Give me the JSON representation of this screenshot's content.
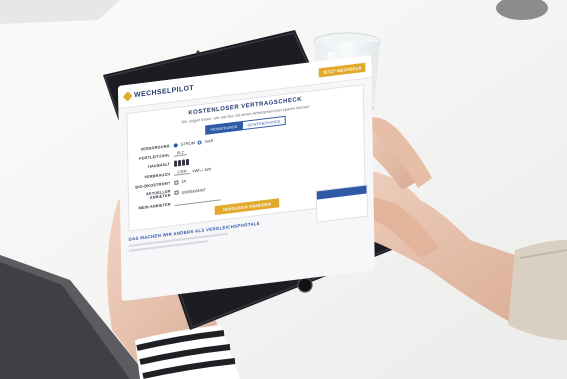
{
  "screen": {
    "logo": "WECHSELPILOT",
    "header_button": "JETZT WECHSELN",
    "card_title": "KOSTENLOSER VERTRAGSCHECK",
    "subtitle": "Wir zeigen Ihnen, wie viel Sie mit einem Anbieterwechsel sparen können",
    "tabs": [
      {
        "label": "PRIVATKUNDE",
        "active": true
      },
      {
        "label": "GEWERBEKUNDE",
        "active": false
      }
    ],
    "rows": {
      "versorgung": {
        "label": "VERSORGUNG",
        "options": [
          "STROM",
          "GAS"
        ],
        "selected": "STROM"
      },
      "postleitzahl": {
        "label": "POSTLEITZAHL",
        "placeholder": "PLZ"
      },
      "haushalt": {
        "label": "HAUSHALT",
        "people": 4
      },
      "verbrauch": {
        "label": "VERBRAUCH",
        "value": "2.500",
        "unit": "kWh / Jahr"
      },
      "oekostrom": {
        "label": "BIO-ÖKOSTROM?",
        "option": "JA"
      },
      "anbieter": {
        "label": "AKTUELLER ANBIETER",
        "option": "UNBEKANNT"
      },
      "mein_anbieter": {
        "label": "MEIN ANBIETER"
      }
    },
    "cta": "VERGLEICH ANZEIGEN",
    "footer_title": "DAS MACHEN WIR ANDERS ALS VERGLEICHSPORTALE"
  },
  "colors": {
    "brand_navy": "#223a6b",
    "accent_gold": "#e2a92a",
    "link_blue": "#2f5aa8",
    "tablet_body": "#1b1d22",
    "background": "#f4f4f2"
  }
}
